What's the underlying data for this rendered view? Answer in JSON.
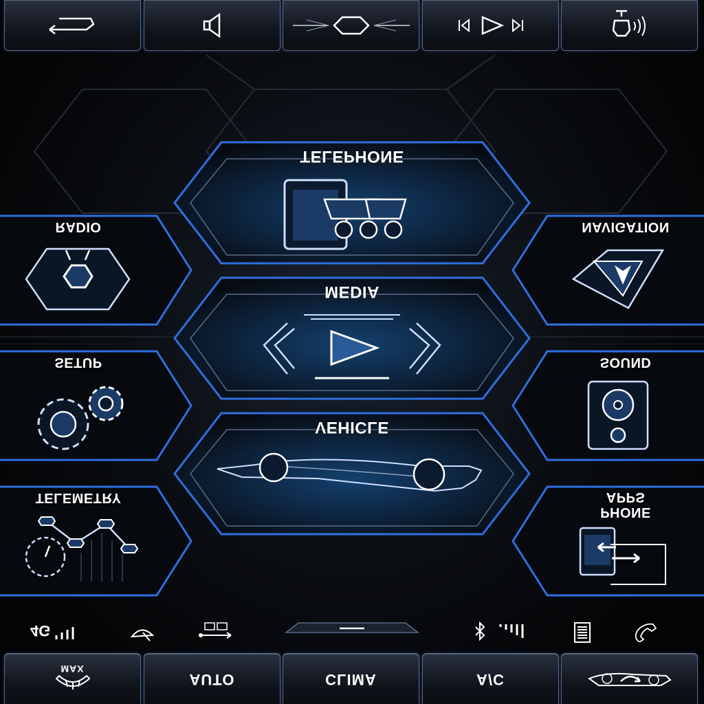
{
  "top_bar": {
    "items": [
      {
        "name": "back",
        "icon": "back-arrow-icon"
      },
      {
        "name": "volume",
        "icon": "speaker-icon"
      },
      {
        "name": "home",
        "icon": "hexagon-home-icon"
      },
      {
        "name": "media-controls",
        "icon": "prev-play-next-icon"
      },
      {
        "name": "voice",
        "icon": "voice-command-icon"
      }
    ]
  },
  "tiles": {
    "telephone": "TELEPHONE",
    "media": "MEDIA",
    "vehicle": "VEHICLE",
    "radio": "RADIO",
    "setup": "SETUP",
    "telemetry": "TELEMETRY",
    "navigation": "NAVIGATION",
    "sound": "SOUND",
    "phone_apps_line1": "PHONE",
    "phone_apps_line2": "APPS"
  },
  "status_bar": {
    "network": "4G",
    "icons": [
      "signal-icon",
      "wiper-icon",
      "usb-icon",
      "bluetooth-icon",
      "signal-bars-icon",
      "battery-icon",
      "phone-handset-icon"
    ]
  },
  "bottom_bar": {
    "max": "MAX",
    "auto": "AUTO",
    "clima": "CLIMA",
    "ac": "A/C",
    "recirc_icon": "air-recirculation-icon"
  },
  "colors": {
    "accent": "#2f6fe0",
    "glow": "#3a8cff",
    "frame": "#5b6b86",
    "background": "#050608"
  }
}
